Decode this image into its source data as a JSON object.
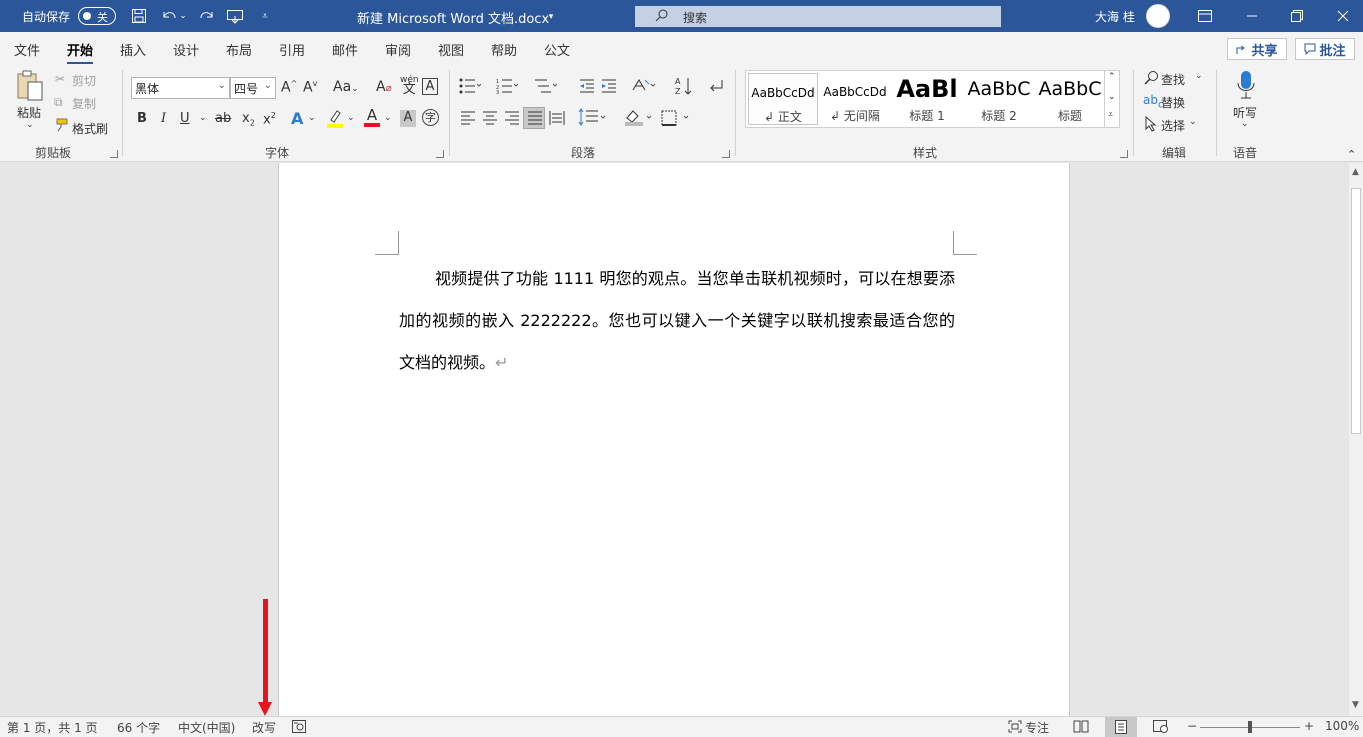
{
  "titlebar": {
    "autosave_label": "自动保存",
    "autosave_state": "关",
    "doc_title": "新建 Microsoft Word 文档.docx",
    "search_placeholder": "搜索",
    "user_name": "大海 桂"
  },
  "tabs": [
    "文件",
    "开始",
    "插入",
    "设计",
    "布局",
    "引用",
    "邮件",
    "审阅",
    "视图",
    "帮助",
    "公文"
  ],
  "active_tab": "开始",
  "share_label": "共享",
  "comment_label": "批注",
  "ribbon": {
    "clipboard": {
      "paste": "粘贴",
      "cut": "剪切",
      "copy": "复制",
      "format_painter": "格式刷",
      "label": "剪贴板"
    },
    "font": {
      "font_name": "黑体",
      "font_size": "四号",
      "case_btn": "Aa",
      "label": "字体"
    },
    "paragraph": {
      "label": "段落"
    },
    "styles": {
      "items": [
        {
          "preview": "AaBbCcDd",
          "name": "正文"
        },
        {
          "preview": "AaBbCcDd",
          "name": "无间隔"
        },
        {
          "preview": "AaBl",
          "name": "标题 1"
        },
        {
          "preview": "AaBbC",
          "name": "标题 2"
        },
        {
          "preview": "AaBbC",
          "name": "标题"
        }
      ],
      "label": "样式"
    },
    "editing": {
      "find": "查找",
      "replace": "替换",
      "select": "选择",
      "label": "编辑"
    },
    "voice": {
      "dictate": "听写",
      "label": "语音"
    }
  },
  "document": {
    "paragraph": "视频提供了功能 1111 明您的观点。当您单击联机视频时，可以在想要添加的视频的嵌入 2222222。您也可以键入一个关键字以联机搜索最适合您的文档的视频。",
    "para_mark": "↵"
  },
  "statusbar": {
    "page": "第 1 页，共 1 页",
    "words": "66 个字",
    "language": "中文(中国)",
    "mode": "改写",
    "focus": "专注",
    "zoom_minus": "−",
    "zoom_plus": "+",
    "zoom": "100%"
  },
  "colors": {
    "title_bar": "#2b579a",
    "arrow": "#e8141b",
    "highlight": "#ffff00",
    "font_color": "#e81123"
  }
}
